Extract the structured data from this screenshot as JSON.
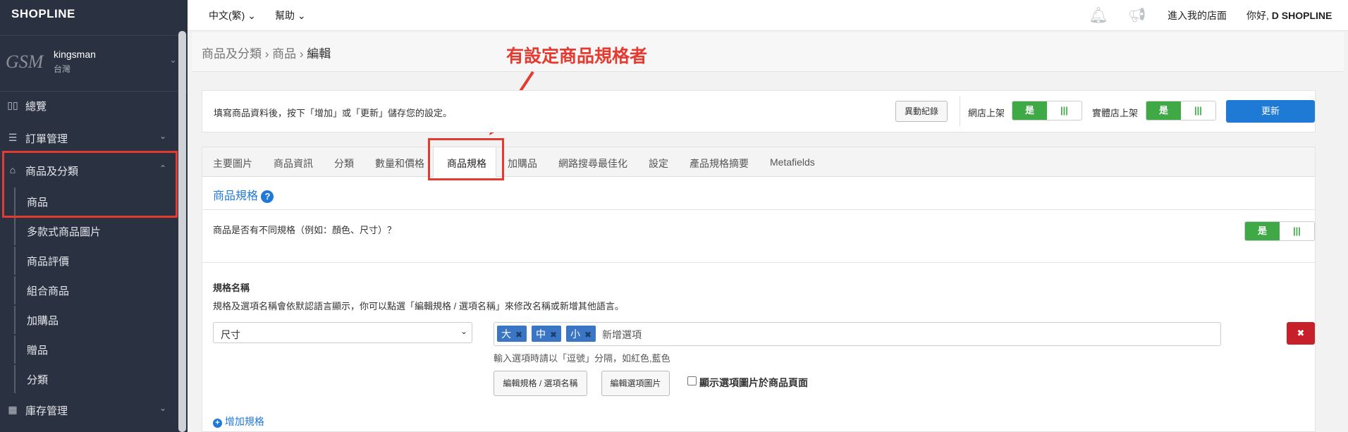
{
  "app": {
    "logo": "SHOPLINE"
  },
  "store": {
    "logo_text": "GSM",
    "name": "kingsman",
    "region": "台灣"
  },
  "sidebar": {
    "items": [
      {
        "label": "總覽",
        "icon": "dashboard-icon"
      },
      {
        "label": "訂單管理",
        "icon": "orders-icon"
      },
      {
        "label": "商品及分類",
        "icon": "bag-icon"
      },
      {
        "label": "庫存管理",
        "icon": "inventory-icon"
      }
    ],
    "subitems": [
      "商品",
      "多款式商品圖片",
      "商品評價",
      "組合商品",
      "加購品",
      "贈品",
      "分類"
    ]
  },
  "topbar": {
    "language": "中文(繁)",
    "help": "幫助",
    "store_link": "進入我的店面",
    "greeting": "你好, ",
    "user": "D SHOPLINE"
  },
  "breadcrumb": {
    "level1": "商品及分類",
    "level2": "商品",
    "current": "編輯"
  },
  "annotation": "有設定商品規格者",
  "info": {
    "text": "填寫商品資料後，按下「增加」或「更新」儲存您的設定。",
    "history_button": "異動紀錄",
    "online_label": "網店上架",
    "retail_label": "實體店上架",
    "toggle_yes": "是",
    "toggle_bars": "|||",
    "update_button": "更新"
  },
  "tabs": [
    "主要圖片",
    "商品資訊",
    "分類",
    "數量和價格",
    "商品規格",
    "加購品",
    "網路搜尋最佳化",
    "設定",
    "產品規格摘要",
    "Metafields"
  ],
  "variants": {
    "title": "商品規格",
    "question": "商品是否有不同規格（例如：顏色、尺寸）？",
    "spec_name_title": "規格名稱",
    "spec_desc": "規格及選項名稱會依默認語言顯示，你可以點選「編輯規格 / 選項名稱」來修改名稱或新增其他語言。",
    "select_value": "尺寸",
    "options": [
      "大",
      "中",
      "小"
    ],
    "option_placeholder": "新增選項",
    "hint": "輸入選項時請以「逗號」分隔，如紅色,藍色",
    "edit_names_button": "編輯規格 / 選項名稱",
    "edit_images_button": "編輯選項圖片",
    "show_images_label": "顯示選項圖片於商品頁面",
    "add_variant": "增加規格",
    "remove_symbol": "✖"
  },
  "colors": {
    "accent_blue": "#1f7ad6",
    "success_green": "#3ea945",
    "danger_red": "#c8202a",
    "annotation_red": "#e53a30",
    "sidebar_bg": "#2a3140"
  }
}
